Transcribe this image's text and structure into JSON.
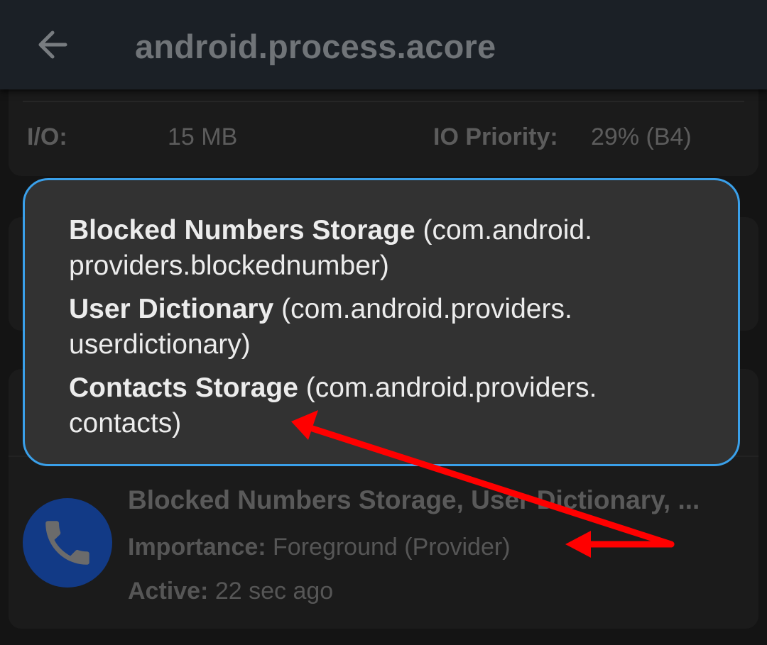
{
  "appbar": {
    "title": "android.process.acore"
  },
  "io_card": {
    "io_label": "I/O:",
    "io_value": "15 MB",
    "priority_label": "IO Priority:",
    "priority_value": "29% (B4)"
  },
  "tooltip": {
    "entries": [
      {
        "name": "Blocked Numbers Storage",
        "package_line1": " (com.android.",
        "package_line2": "providers.blockednumber)"
      },
      {
        "name": "User Dictionary",
        "package_line1": " (com.android.providers.",
        "package_line2": "userdictionary)"
      },
      {
        "name": "Contacts Storage",
        "package_line1": " (com.android.providers.",
        "package_line2": "contacts)"
      }
    ]
  },
  "process_item": {
    "icon": "phone-icon",
    "name": "Blocked Numbers Storage, User Dictionary, ...",
    "importance_label": "Importance:",
    "importance_value": " Foreground (Provider)",
    "active_label": "Active:",
    "active_value": " 22 sec ago"
  },
  "colors": {
    "appbar_bg": "#1b2026",
    "tooltip_border": "#3aa0ea",
    "avatar_bg": "#123a86",
    "annotation_arrow": "#ff0000"
  }
}
